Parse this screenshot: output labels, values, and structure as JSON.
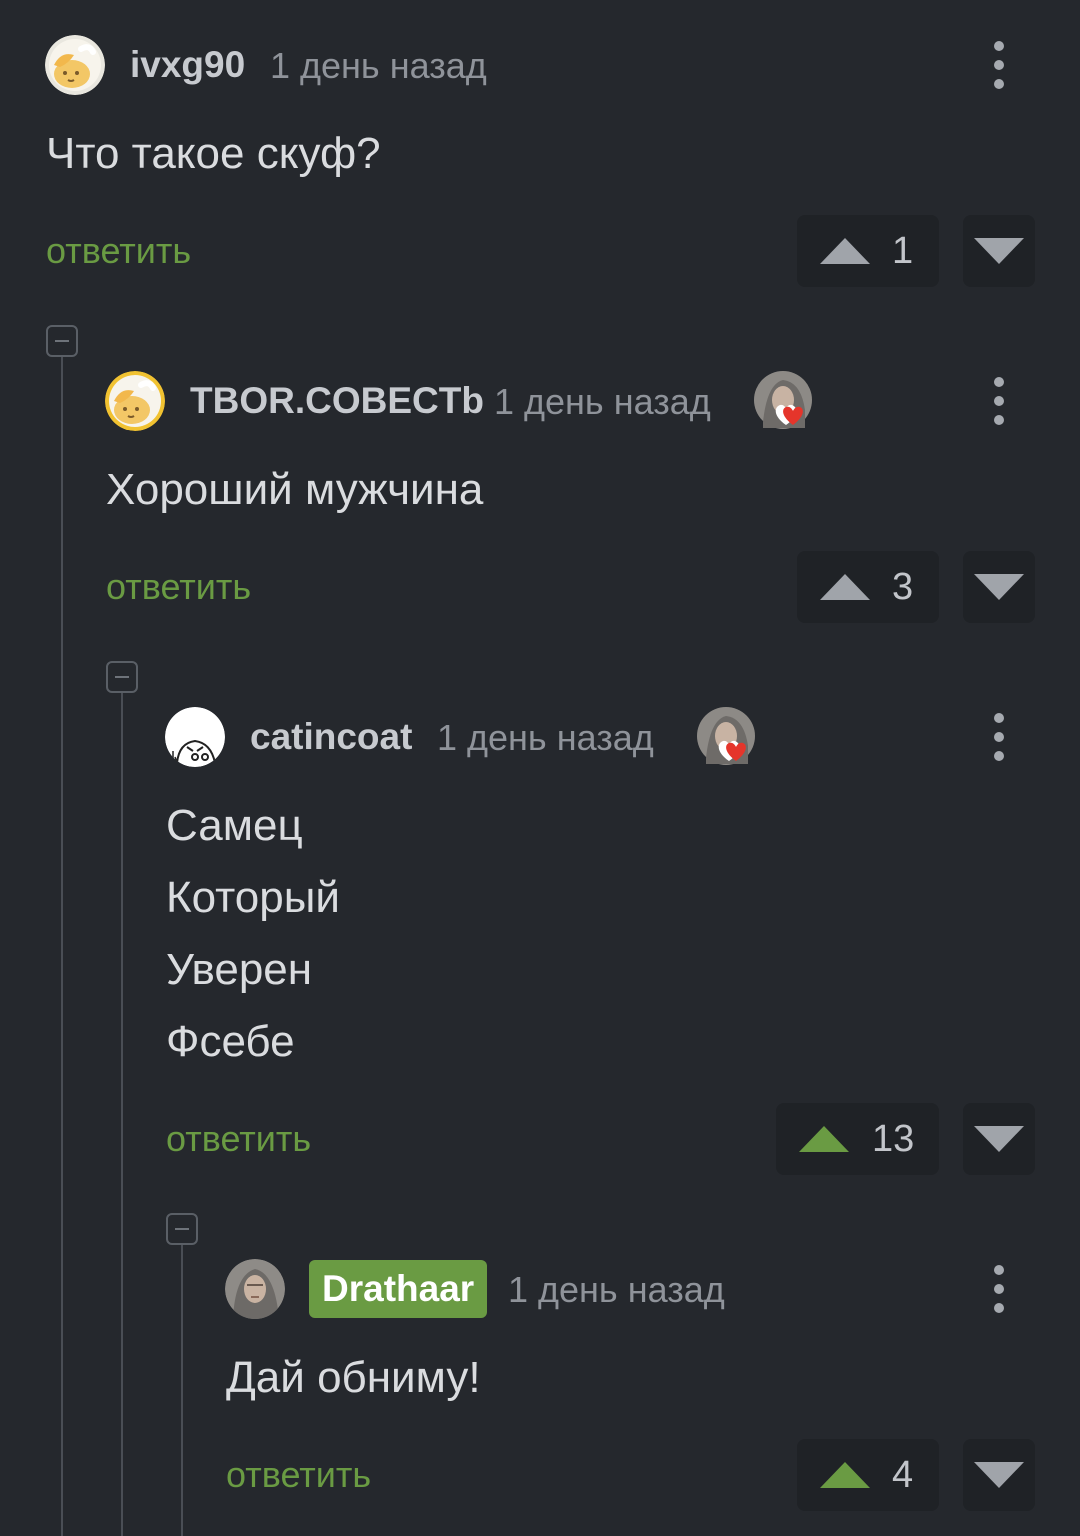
{
  "comments": [
    {
      "username": "ivxg90",
      "time": "1 день назад",
      "text_lines": [
        "Что такое скуф?"
      ],
      "reply_label": "ответить",
      "votes": 1,
      "upvoted": false
    },
    {
      "username": "TBOR.COBECTb",
      "time": "1 день назад",
      "text_lines": [
        "Хороший мужчина"
      ],
      "reply_label": "ответить",
      "votes": 3,
      "upvoted": false,
      "liked_by_author": true
    },
    {
      "username": "catincoat",
      "time": "1 день назад",
      "text_lines": [
        "Самец",
        "Который",
        "Уверен",
        "Фсебе"
      ],
      "reply_label": "ответить",
      "votes": 13,
      "upvoted": true,
      "liked_by_author": true
    },
    {
      "username": "Drathaar",
      "time": "1 день назад",
      "text_lines": [
        "Дай обниму!"
      ],
      "reply_label": "ответить",
      "votes": 4,
      "upvoted": true,
      "is_post_author": true
    }
  ],
  "colors": {
    "background": "#25282d",
    "accent_green": "#6a9b43",
    "vote_box": "#1f2226",
    "heart": "#e5352b"
  },
  "icons": {
    "more": "more-vertical-icon",
    "upvote": "triangle-up-icon",
    "downvote": "triangle-down-icon",
    "collapse": "minus-square-icon",
    "liked": "heart-icon"
  }
}
